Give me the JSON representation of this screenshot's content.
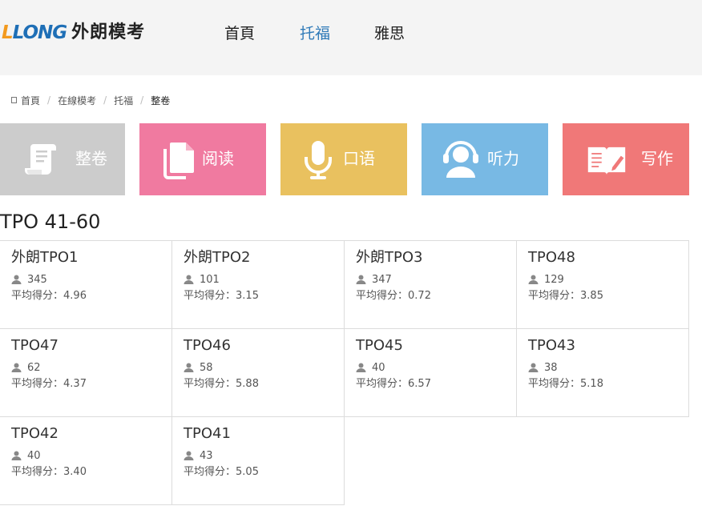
{
  "header": {
    "logo": {
      "mark_a": "L",
      "mark_b": "LONG",
      "name": "外朗模考"
    },
    "nav": [
      {
        "label": "首頁",
        "active": false
      },
      {
        "label": "托福",
        "active": true
      },
      {
        "label": "雅思",
        "active": false
      }
    ],
    "colors": {
      "background": "#f4f4f4",
      "active_nav": "#2f7ab8"
    }
  },
  "breadcrumb": {
    "icon": "home-icon",
    "items": [
      "首頁",
      "在線模考",
      "托福",
      "整卷"
    ]
  },
  "tiles": [
    {
      "label": "整卷",
      "icon": "paper-scroll-icon",
      "color": "#cccccc"
    },
    {
      "label": "阅读",
      "icon": "document-icon",
      "color": "#f07aa0"
    },
    {
      "label": "口语",
      "icon": "microphone-icon",
      "color": "#e9c15f"
    },
    {
      "label": "听力",
      "icon": "headset-icon",
      "color": "#78b9e4"
    },
    {
      "label": "写作",
      "icon": "book-pen-icon",
      "color": "#f07878"
    }
  ],
  "section_title": "TPO 41-60",
  "tests": [
    {
      "title": "外朗TPO1",
      "count": "345",
      "score_label": "平均得分：",
      "score": "4.96"
    },
    {
      "title": "外朗TPO2",
      "count": "101",
      "score_label": "平均得分：",
      "score": "3.15"
    },
    {
      "title": "外朗TPO3",
      "count": "347",
      "score_label": "平均得分：",
      "score": "0.72"
    },
    {
      "title": "TPO48",
      "count": "129",
      "score_label": "平均得分：",
      "score": "3.85"
    },
    {
      "title": "TPO47",
      "count": "62",
      "score_label": "平均得分：",
      "score": "4.37"
    },
    {
      "title": "TPO46",
      "count": "58",
      "score_label": "平均得分：",
      "score": "5.88"
    },
    {
      "title": "TPO45",
      "count": "40",
      "score_label": "平均得分：",
      "score": "6.57"
    },
    {
      "title": "TPO43",
      "count": "38",
      "score_label": "平均得分：",
      "score": "5.18"
    },
    {
      "title": "TPO42",
      "count": "40",
      "score_label": "平均得分：",
      "score": "3.40"
    },
    {
      "title": "TPO41",
      "count": "43",
      "score_label": "平均得分：",
      "score": "5.05"
    }
  ]
}
